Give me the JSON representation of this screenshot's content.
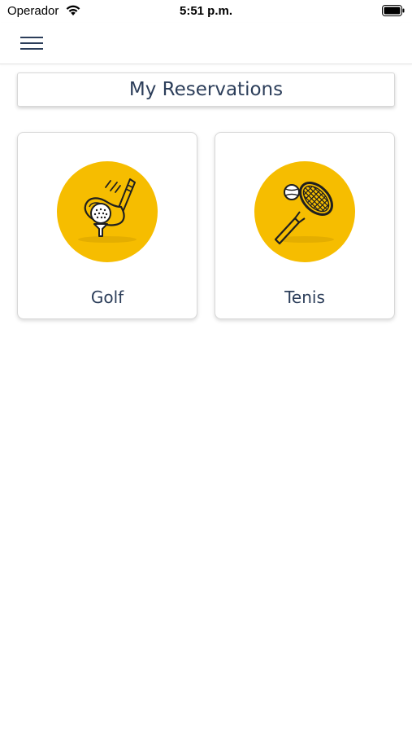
{
  "status_bar": {
    "carrier": "Operador",
    "time": "5:51 p.m."
  },
  "header": {
    "menu_icon": "hamburger-menu-icon"
  },
  "page": {
    "title": "My Reservations"
  },
  "cards": [
    {
      "label": "Golf",
      "icon": "golf-club-ball-icon"
    },
    {
      "label": "Tenis",
      "icon": "tennis-racket-ball-icon"
    }
  ],
  "colors": {
    "accent": "#f6bd00",
    "text": "#2c3e5a"
  }
}
